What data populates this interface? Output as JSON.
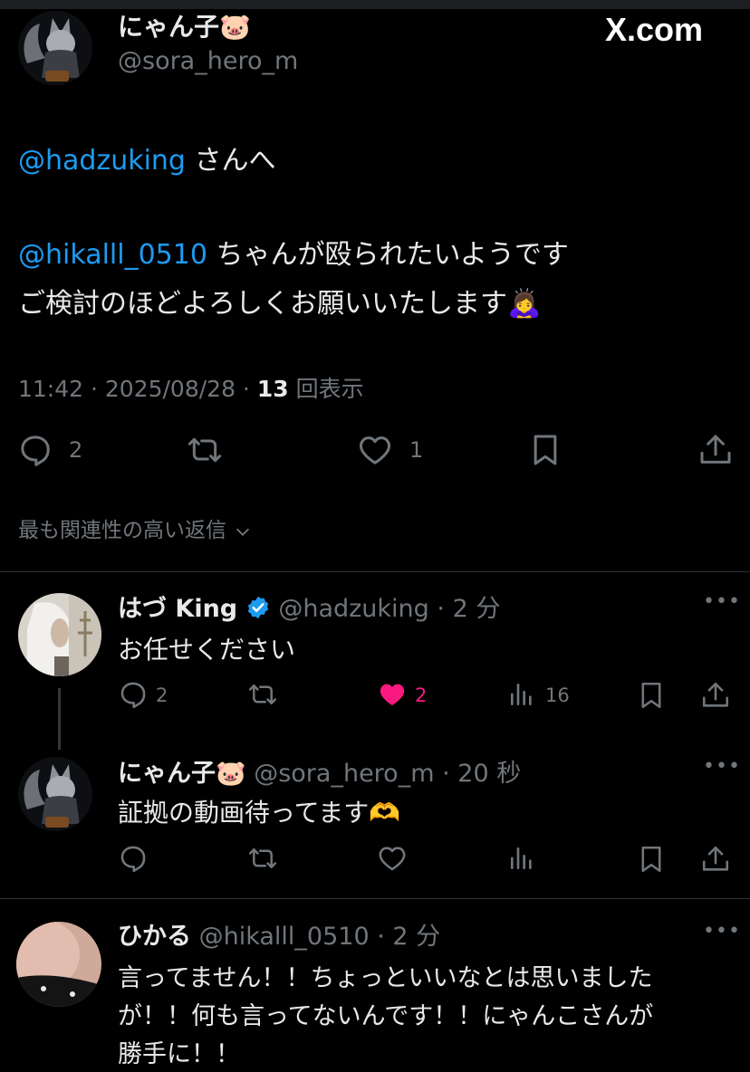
{
  "watermark": "X.com",
  "main_post": {
    "display_name": "にゃん子🐷",
    "handle": "@sora_hero_m",
    "line1_mention": "@hadzuking",
    "line1_text": " さんへ",
    "line2_mention": "@hikalll_0510",
    "line2_text": " ちゃんが殴られたいようです",
    "line3_text": "ご検討のほどよろしくお願いいたします🙇‍♀️",
    "timestamp": "11:42 · 2025/08/28 · ",
    "views_count": "13",
    "views_label": " 回表示",
    "reply_count": "2",
    "like_count": "1"
  },
  "relevant_replies_label": "最も関連性の高い返信",
  "replies": [
    {
      "display_name": "はづ King",
      "handle": "@hadzuking",
      "time": "· 2 分",
      "text": "お任せください",
      "reply_count": "2",
      "like_count": "2",
      "view_count": "16",
      "liked": true
    },
    {
      "display_name": "にゃん子🐷",
      "handle": "@sora_hero_m",
      "time": "· 20 秒",
      "text": "証拠の動画待ってます🫶"
    },
    {
      "display_name": "ひかる",
      "handle": "@hikalll_0510",
      "time": "· 2 分",
      "text_lines": [
        "言ってません！！ちょっといいなとは思いました",
        "が！！何も言ってないんです！！にゃんこさんが",
        "勝手に！！"
      ]
    }
  ],
  "colors": {
    "accent": "#1d9bf0",
    "like": "#f91880",
    "muted": "#71767b",
    "text": "#e7e9ea"
  }
}
